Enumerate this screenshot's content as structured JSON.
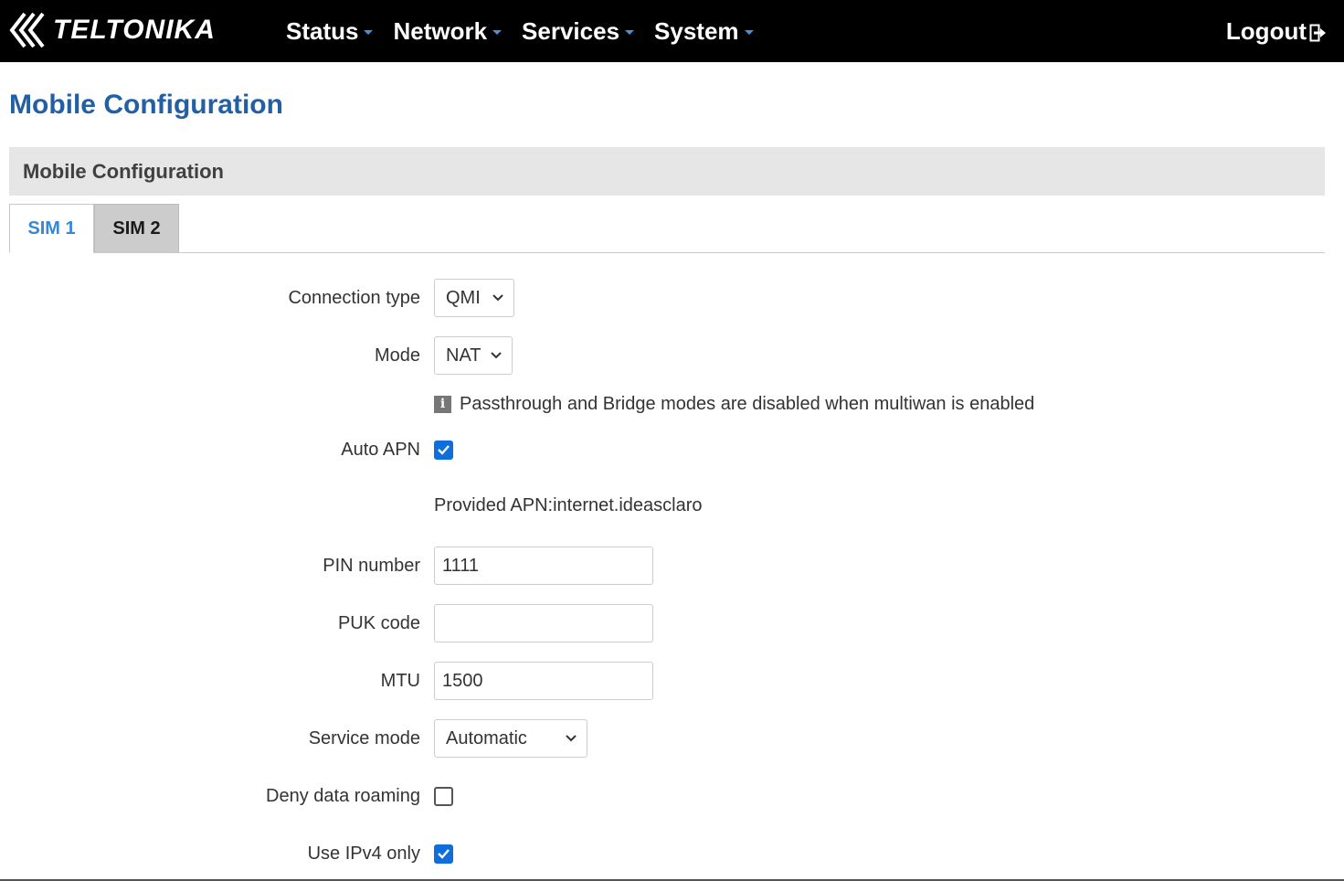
{
  "brand": {
    "name": "TELTONIKA"
  },
  "nav": {
    "items": [
      {
        "label": "Status"
      },
      {
        "label": "Network"
      },
      {
        "label": "Services"
      },
      {
        "label": "System"
      }
    ],
    "logout_label": "Logout"
  },
  "page": {
    "title": "Mobile Configuration",
    "section_title": "Mobile Configuration"
  },
  "tabs": [
    {
      "label": "SIM 1",
      "active": true
    },
    {
      "label": "SIM 2",
      "active": false
    }
  ],
  "form": {
    "connection_type": {
      "label": "Connection type",
      "value": "QMI"
    },
    "mode": {
      "label": "Mode",
      "value": "NAT"
    },
    "mode_info": "Passthrough and Bridge modes are disabled when multiwan is enabled",
    "auto_apn": {
      "label": "Auto APN",
      "checked": true
    },
    "provided_apn": "Provided APN:internet.ideasclaro",
    "pin_number": {
      "label": "PIN number",
      "value": "1111",
      "placeholder": ""
    },
    "puk_code": {
      "label": "PUK code",
      "value": "",
      "placeholder": ""
    },
    "mtu": {
      "label": "MTU",
      "value": "1500",
      "placeholder": ""
    },
    "service_mode": {
      "label": "Service mode",
      "value": "Automatic"
    },
    "deny_data_roaming": {
      "label": "Deny data roaming",
      "checked": false
    },
    "use_ipv4_only": {
      "label": "Use IPv4 only",
      "checked": true
    }
  },
  "colors": {
    "topbar": "#000000",
    "title_blue": "#235fa5",
    "active_tab": "#3a87d6",
    "checkbox_blue": "#0e6fdc",
    "section_bg": "#e6e6e6"
  },
  "icons": [
    "teltonika-logo-icon",
    "caret-down-icon",
    "logout-icon",
    "info-icon",
    "chevron-down-icon",
    "checkmark-icon"
  ]
}
